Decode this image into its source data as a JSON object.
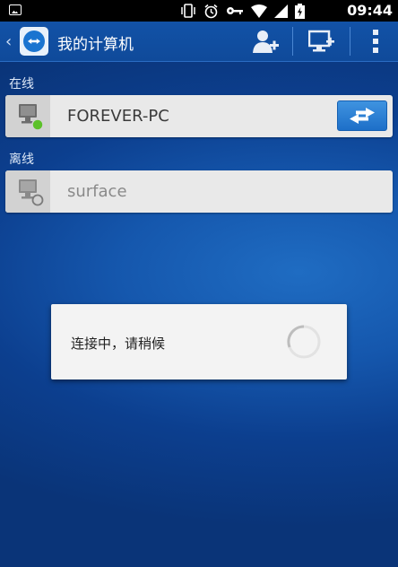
{
  "status_bar": {
    "time": "09:44",
    "icons": [
      "image-icon",
      "vibrate-icon",
      "alarm-icon",
      "key-icon",
      "wifi-icon",
      "signal-icon",
      "battery-charging-icon"
    ]
  },
  "action_bar": {
    "title": "我的计算机",
    "actions": [
      "add-contact-icon",
      "add-computer-icon",
      "overflow-menu-icon"
    ]
  },
  "sections": {
    "online_label": "在线",
    "offline_label": "离线"
  },
  "devices": {
    "online": [
      {
        "name": "FOREVER-PC",
        "status": "online"
      }
    ],
    "offline": [
      {
        "name": "surface",
        "status": "offline"
      }
    ]
  },
  "dialog": {
    "message": "连接中，请稍候"
  },
  "colors": {
    "background": "#1557ad",
    "action_bar": "#1252a7",
    "online_dot": "#5cc12a",
    "connect_button": "#2a7ed6"
  }
}
